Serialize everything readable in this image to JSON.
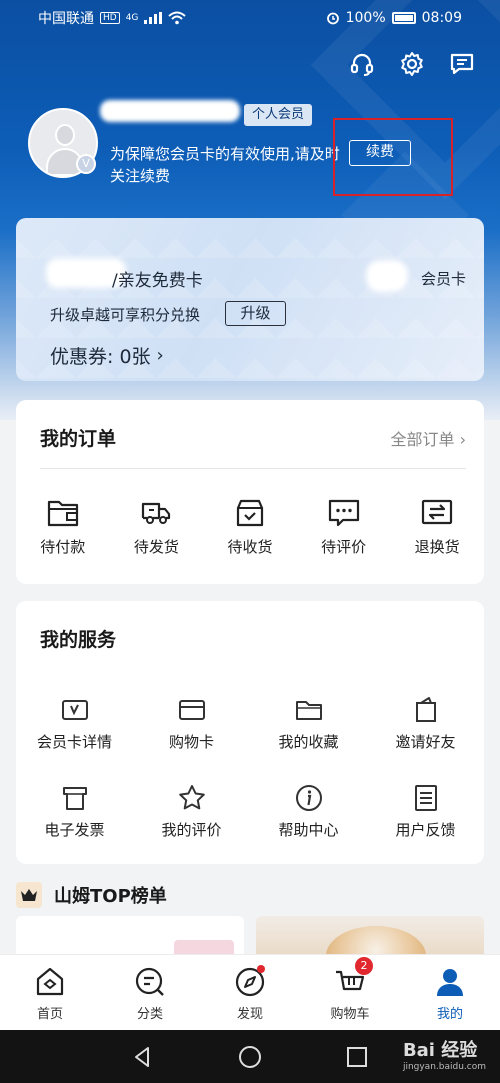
{
  "status_bar": {
    "carrier": "中国联通",
    "hd": "HD",
    "network": "4G",
    "battery": "100%",
    "time": "08:09"
  },
  "header": {
    "membership_badge": "个人会员",
    "notice": "为保障您会员卡的有效使用,请及时关注续费",
    "renew_label": "续费"
  },
  "card": {
    "title": "/亲友免费卡",
    "type": "会员卡",
    "upgrade_text": "升级卓越可享积分兑换",
    "upgrade_label": "升级",
    "coupon_text": "优惠券: 0张",
    "coupon_chevron": "›"
  },
  "orders": {
    "title": "我的订单",
    "all_link": "全部订单 ›",
    "items": [
      {
        "label": "待付款",
        "icon": "wallet-icon"
      },
      {
        "label": "待发货",
        "icon": "truck-icon"
      },
      {
        "label": "待收货",
        "icon": "box-icon"
      },
      {
        "label": "待评价",
        "icon": "comment-icon"
      },
      {
        "label": "退换货",
        "icon": "exchange-icon"
      }
    ]
  },
  "services": {
    "title": "我的服务",
    "row1": [
      {
        "label": "会员卡详情",
        "icon": "member-card-icon"
      },
      {
        "label": "购物卡",
        "icon": "card-icon"
      },
      {
        "label": "我的收藏",
        "icon": "folder-icon"
      },
      {
        "label": "邀请好友",
        "icon": "invite-icon"
      }
    ],
    "row2": [
      {
        "label": "电子发票",
        "icon": "invoice-icon"
      },
      {
        "label": "我的评价",
        "icon": "star-icon"
      },
      {
        "label": "帮助中心",
        "icon": "info-icon"
      },
      {
        "label": "用户反馈",
        "icon": "feedback-icon"
      }
    ]
  },
  "top_section": {
    "title": "山姆TOP榜单"
  },
  "tabbar": {
    "items": [
      {
        "label": "首页",
        "icon": "home-icon"
      },
      {
        "label": "分类",
        "icon": "category-icon"
      },
      {
        "label": "发现",
        "icon": "compass-icon"
      },
      {
        "label": "购物车",
        "icon": "cart-icon",
        "badge": "2"
      },
      {
        "label": "我的",
        "icon": "profile-icon",
        "active": true
      }
    ]
  },
  "watermark": {
    "main": "Bai 经验",
    "sub": "jingyan.baidu.com"
  },
  "colors": {
    "brand_blue": "#0d5db7",
    "highlight_red": "#d8222a",
    "badge_red": "#e0282e"
  }
}
